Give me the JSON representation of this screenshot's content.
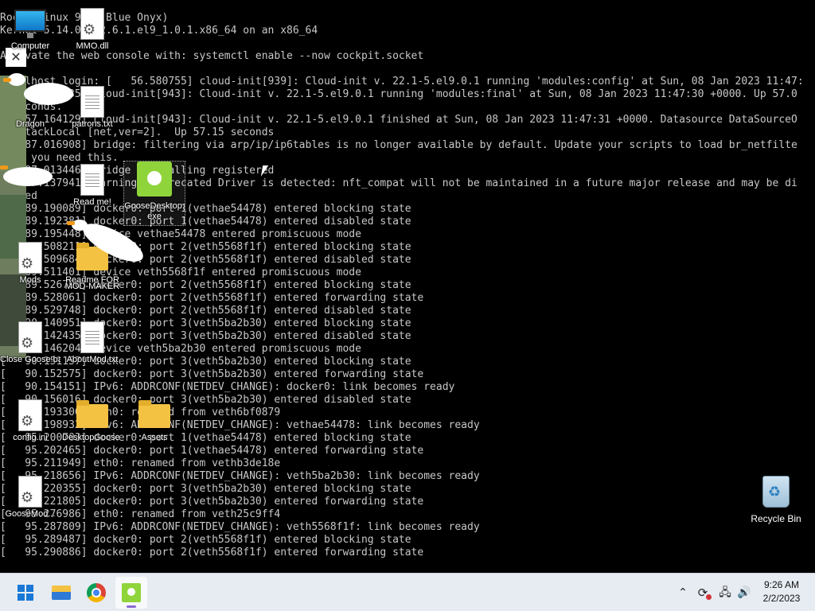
{
  "console_lines": [
    "Rocky Linux 9.1 (Blue Onyx)",
    "Kernel 5.14.0-162.6.1.el9_1.0.1.x86_64 on an x86_64",
    "",
    "Activate the web console with: systemctl enable --now cockpit.socket",
    "",
    "localhost login: [   56.580755] cloud-init[939]: Cloud-init v. 22.1-5.el9.0.1 running 'modules:config' at Sun, 08 Jan 2023 11:47:",
    "[   57.046535] cloud-init[943]: Cloud-init v. 22.1-5.el9.0.1 running 'modules:final' at Sun, 08 Jan 2023 11:47:30 +0000. Up 57.0",
    "2 seconds.",
    "[   57.164129] cloud-init[943]: Cloud-init v. 22.1-5.el9.0.1 finished at Sun, 08 Jan 2023 11:47:31 +0000. Datasource DataSourceO",
    "penStackLocal [net,ver=2].  Up 57.15 seconds",
    "[   87.016908] bridge: filtering via arp/ip/ip6tables is no longer available by default. Update your scripts to load br_netfilte",
    "r if you need this.",
    "[   87.013446] Bridge firewalling registered",
    "[   87.137941] warning: Deprecated Driver is detected: nft_compat will not be maintained in a future major release and may be di",
    "sabled",
    "[   89.190089] docker0: port 1(vethae54478) entered blocking state",
    "[   89.192381] docker0: port 1(vethae54478) entered disabled state",
    "[   89.195448] device vethae54478 entered promiscuous mode",
    "[   89.508211] docker0: port 2(veth5568f1f) entered blocking state",
    "[   89.509684] docker0: port 2(veth5568f1f) entered disabled state",
    "[   89.511401] device veth5568f1f entered promiscuous mode",
    "[   89.526700] docker0: port 2(veth5568f1f) entered blocking state",
    "[   89.528061] docker0: port 2(veth5568f1f) entered forwarding state",
    "[   89.529748] docker0: port 2(veth5568f1f) entered disabled state",
    "[   90.140951] docker0: port 3(veth5ba2b30) entered blocking state",
    "[   90.142435] docker0: port 3(veth5ba2b30) entered disabled state",
    "[   90.146204] device veth5ba2b30 entered promiscuous mode",
    "[   90.151157] docker0: port 3(veth5ba2b30) entered blocking state",
    "[   90.152575] docker0: port 3(veth5ba2b30) entered forwarding state",
    "[   90.154151] IPv6: ADDRCONF(NETDEV_CHANGE): docker0: link becomes ready",
    "[   90.156016] docker0: port 3(veth5ba2b30) entered disabled state",
    "[   95.193306] eth0: renamed from veth6bf0879",
    "[   95.198932] IPv6: ADDRCONF(NETDEV_CHANGE): vethae54478: link becomes ready",
    "[   95.200703] docker0: port 1(vethae54478) entered blocking state",
    "[   95.202465] docker0: port 1(vethae54478) entered forwarding state",
    "[   95.211949] eth0: renamed from vethb3de18e",
    "[   95.218656] IPv6: ADDRCONF(NETDEV_CHANGE): veth5ba2b30: link becomes ready",
    "[   95.220355] docker0: port 3(veth5ba2b30) entered blocking state",
    "[   95.221805] docker0: port 3(veth5ba2b30) entered forwarding state",
    "[   95.276986] eth0: renamed from veth25c9ff4",
    "[   95.287809] IPv6: ADDRCONF(NETDEV_CHANGE): veth5568f1f: link becomes ready",
    "[   95.289487] docker0: port 2(veth5568f1f) entered blocking state",
    "[   95.290886] docker0: port 2(veth5568f1f) entered forwarding state"
  ],
  "desktop_icons": {
    "computer": "Computer",
    "mmo_dll": "MMO.dll",
    "dragon": "Dragon",
    "patrons": "patrons.txt",
    "read_me": "Read me!",
    "goose_exe": "GooseDesktop.exe",
    "mods": "Mods",
    "readme_file": "Readme FOR",
    "mod_maker": "MOD-MAKER",
    "close_goose": "Close Goose.bat",
    "about_text": "AboutMod.txt",
    "config": "config.ini",
    "desktop_goose": "DesktopGoose v0.31",
    "assets": "Assets",
    "goose_mod": "GooseMod...",
    "recycle_bin": "Recycle Bin"
  },
  "close_button": {
    "glyph": "✕"
  },
  "taskbar": {
    "apps": [
      "Start",
      "File Explorer",
      "Google Chrome",
      "Desktop Goose"
    ],
    "active_app": "Desktop Goose",
    "tray": {
      "chevron": "⌃",
      "network": "🖧",
      "volume": "🔊"
    },
    "clock": {
      "time": "9:26 AM",
      "date": "2/2/2023"
    }
  },
  "colors": {
    "console_bg": "#000000",
    "console_text": "#c8c8c8",
    "taskbar_bg": "#e7ecf2",
    "windows_blue": "#1a78d6",
    "goose_green": "#8fd43a",
    "folder_yellow": "#f3c242"
  }
}
